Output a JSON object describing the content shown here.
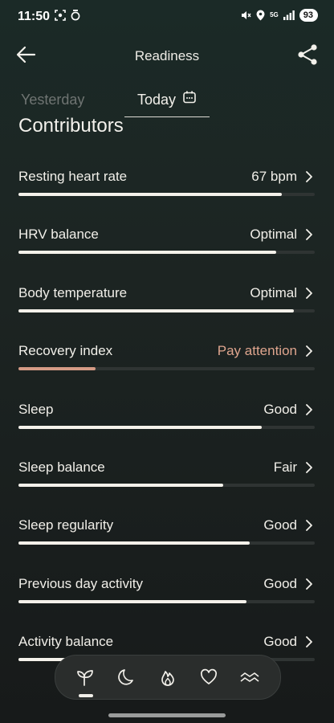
{
  "status": {
    "time": "11:50",
    "network": "5G",
    "battery": "93"
  },
  "header": {
    "title": "Readiness"
  },
  "tabs": [
    {
      "label": "Yesterday",
      "active": false
    },
    {
      "label": "Today",
      "active": true
    }
  ],
  "section": {
    "title": "Contributors"
  },
  "contributors": [
    {
      "label": "Resting heart rate",
      "value": "67 bpm",
      "level": 0.89,
      "status": "normal"
    },
    {
      "label": "HRV balance",
      "value": "Optimal",
      "level": 0.87,
      "status": "normal"
    },
    {
      "label": "Body temperature",
      "value": "Optimal",
      "level": 0.93,
      "status": "normal"
    },
    {
      "label": "Recovery index",
      "value": "Pay attention",
      "level": 0.26,
      "status": "attention"
    },
    {
      "label": "Sleep",
      "value": "Good",
      "level": 0.82,
      "status": "normal"
    },
    {
      "label": "Sleep balance",
      "value": "Fair",
      "level": 0.69,
      "status": "normal"
    },
    {
      "label": "Sleep regularity",
      "value": "Good",
      "level": 0.78,
      "status": "normal"
    },
    {
      "label": "Previous day activity",
      "value": "Good",
      "level": 0.77,
      "status": "normal"
    },
    {
      "label": "Activity balance",
      "value": "Good",
      "level": 0.72,
      "status": "normal"
    }
  ],
  "nav": {
    "items": [
      "sprout-icon",
      "moon-icon",
      "flame-icon",
      "heart-icon",
      "waves-icon"
    ],
    "active_index": 0
  },
  "colors": {
    "attention": "#d49a85",
    "bar_fill": "#f4f1ea",
    "bar_track": "#2f3433"
  }
}
